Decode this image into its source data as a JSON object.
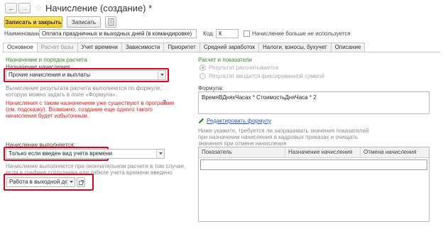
{
  "header": {
    "title": "Начисление (создание) *"
  },
  "toolbar": {
    "save_close_label": "Записать и закрыть",
    "save_label": "Записать"
  },
  "name_row": {
    "name_label": "Наименование:",
    "name_value": "Оплата праздничных и выходных дней (в командировке)",
    "code_label": "Код:",
    "code_value": "К",
    "unused_label": "Начисление больше не используется"
  },
  "tabs": [
    {
      "label": "Основное",
      "state": "active"
    },
    {
      "label": "Расчет базы",
      "state": "disabled"
    },
    {
      "label": "Учет времени",
      "state": "normal"
    },
    {
      "label": "Зависимости",
      "state": "normal"
    },
    {
      "label": "Приоритет",
      "state": "normal"
    },
    {
      "label": "Средний заработок",
      "state": "normal"
    },
    {
      "label": "Налоги, взносы, бухучет",
      "state": "normal"
    },
    {
      "label": "Описание",
      "state": "normal"
    }
  ],
  "left": {
    "section_title": "Назначение и порядок расчета",
    "purpose_label": "Назначение начисления",
    "purpose_value": "Прочие начисления и выплаты",
    "calc_hint_1": "Вычисление результата расчета выполняется по формуле,",
    "calc_hint_2": "которую можно задать в поле «Формула».",
    "warning_1": "Начисления с таким назначением уже существуют в программе",
    "warning_2": "(см. подсказку). Возможно, создание еще одного такого",
    "warning_3": "начисления будет избыточным.",
    "help_mark": "?",
    "executed_label": "Начисление выполняется:",
    "executed_value": "Только если введен вид учета времени",
    "executed_hint_1": "Начисление выполняется при окончательном расчете в том случае,",
    "executed_hint_2": "если в графике сотрудника или табеле учета времени введено",
    "time_type_value": "Работа в выходной день"
  },
  "right": {
    "section_title": "Расчет и показатели",
    "radio_1": "Результат рассчитывается",
    "radio_2": "Результат вводится фиксированной суммой",
    "formula_label": "Формула:",
    "formula_value": "ВремяВДняхЧасах * СтоимостьДняЧаса * 2",
    "edit_formula_link": "Редактировать формулу",
    "indicators_hint_1": "Ниже укажите, требуется ли запрашивать значения показателей",
    "indicators_hint_2": "при назначении начисления в кадровых приказах и очищать",
    "indicators_hint_3": "значения при отмене начисления",
    "table": {
      "columns": [
        "Показатель",
        "Назначение начисления",
        "Отмена начисления"
      ]
    }
  },
  "colors": {
    "primary_button": "#f7cf2a",
    "section_title": "#3a8a2a",
    "warning": "#d8201e",
    "highlight": "#e2001a",
    "link": "#2a5aa8"
  }
}
